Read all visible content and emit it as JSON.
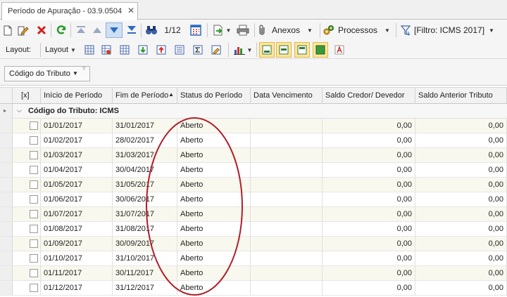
{
  "tab": {
    "title": "Período de Apuração - 03.9.0504",
    "close": "✕"
  },
  "toolbar": {
    "record_position": "1/12",
    "attachments_label": "Anexos",
    "processes_label": "Processos",
    "filter_label": "[Filtro: ICMS 2017]"
  },
  "toolbar2": {
    "layout_label": "Layout:",
    "layout_dropdown": "Layout"
  },
  "groupbar": {
    "group_chip": "Código do Tributo"
  },
  "grid": {
    "columns": {
      "checkbox": "[x]",
      "inicio": "Início de Período",
      "fim": "Fim de Período",
      "status": "Status do Período",
      "vencimento": "Data Vencimento",
      "saldo": "Saldo Credor/ Devedor",
      "saldo_anterior": "Saldo Anterior Tributo"
    },
    "group_label": "Código do Tributo: ICMS",
    "rows": [
      {
        "inicio": "01/01/2017",
        "fim": "31/01/2017",
        "status": "Aberto",
        "saldo": "0,00",
        "saldo_anterior": "0,00"
      },
      {
        "inicio": "01/02/2017",
        "fim": "28/02/2017",
        "status": "Aberto",
        "saldo": "0,00",
        "saldo_anterior": "0,00"
      },
      {
        "inicio": "01/03/2017",
        "fim": "31/03/2017",
        "status": "Aberto",
        "saldo": "0,00",
        "saldo_anterior": "0,00"
      },
      {
        "inicio": "01/04/2017",
        "fim": "30/04/2017",
        "status": "Aberto",
        "saldo": "0,00",
        "saldo_anterior": "0,00"
      },
      {
        "inicio": "01/05/2017",
        "fim": "31/05/2017",
        "status": "Aberto",
        "saldo": "0,00",
        "saldo_anterior": "0,00"
      },
      {
        "inicio": "01/06/2017",
        "fim": "30/06/2017",
        "status": "Aberto",
        "saldo": "0,00",
        "saldo_anterior": "0,00"
      },
      {
        "inicio": "01/07/2017",
        "fim": "31/07/2017",
        "status": "Aberto",
        "saldo": "0,00",
        "saldo_anterior": "0,00"
      },
      {
        "inicio": "01/08/2017",
        "fim": "31/08/2017",
        "status": "Aberto",
        "saldo": "0,00",
        "saldo_anterior": "0,00"
      },
      {
        "inicio": "01/09/2017",
        "fim": "30/09/2017",
        "status": "Aberto",
        "saldo": "0,00",
        "saldo_anterior": "0,00"
      },
      {
        "inicio": "01/10/2017",
        "fim": "31/10/2017",
        "status": "Aberto",
        "saldo": "0,00",
        "saldo_anterior": "0,00"
      },
      {
        "inicio": "01/11/2017",
        "fim": "30/11/2017",
        "status": "Aberto",
        "saldo": "0,00",
        "saldo_anterior": "0,00"
      },
      {
        "inicio": "01/12/2017",
        "fim": "31/12/2017",
        "status": "Aberto",
        "saldo": "0,00",
        "saldo_anterior": "0,00"
      }
    ]
  },
  "colors": {
    "accent_blue": "#2b6cc4",
    "annotation_red": "#b01e2a",
    "row_alt": "#f9f8ee",
    "delete_red": "#d32020",
    "refresh_green": "#2a9a2a"
  }
}
